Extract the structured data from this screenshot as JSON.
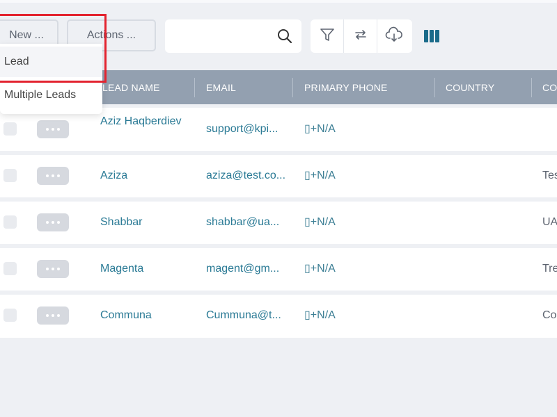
{
  "toolbar": {
    "new_label": "New ...",
    "actions_label": "Actions ...",
    "search_placeholder": "",
    "search_value": ""
  },
  "dropdown": {
    "items": [
      "Lead",
      "Multiple Leads"
    ]
  },
  "table": {
    "columns": [
      "LEAD NAME",
      "EMAIL",
      "PRIMARY PHONE",
      "COUNTRY",
      "CO"
    ],
    "rows": [
      {
        "name": "Aziz Haqberdiev",
        "email": "support@kpi...",
        "phone": "▯+N/A",
        "col5": ""
      },
      {
        "name": "Aziza",
        "email": "aziza@test.co...",
        "phone": "▯+N/A",
        "col5": "Tes"
      },
      {
        "name": "Shabbar",
        "email": "shabbar@ua...",
        "phone": "▯+N/A",
        "col5": "UA"
      },
      {
        "name": "Magenta",
        "email": "magent@gm...",
        "phone": "▯+N/A",
        "col5": "Tre"
      },
      {
        "name": "Communa",
        "email": "Cummuna@t...",
        "phone": "▯+N/A",
        "col5": "Co"
      }
    ]
  },
  "colors": {
    "accent": "#1a6b8a",
    "header_bg": "#93a0b0",
    "highlight": "#e3232f"
  },
  "icons": [
    "search-icon",
    "filter-icon",
    "swap-icon",
    "cloud-download-icon",
    "columns-icon",
    "more-dots-icon"
  ]
}
